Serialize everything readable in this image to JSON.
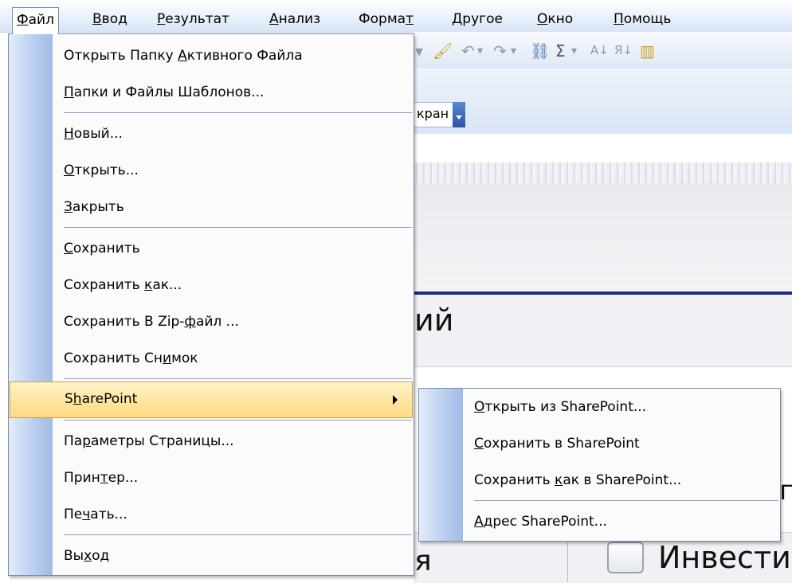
{
  "menubar": [
    {
      "pre": "",
      "u": "Ф",
      "post": "айл",
      "active": true
    },
    {
      "pre": "",
      "u": "В",
      "post": "вод"
    },
    {
      "pre": "",
      "u": "Р",
      "post": "езультат"
    },
    {
      "pre": "",
      "u": "А",
      "post": "нализ"
    },
    {
      "pre": "Форма",
      "u": "т",
      "post": ""
    },
    {
      "pre": "",
      "u": "Д",
      "post": "ругое"
    },
    {
      "pre": "",
      "u": "О",
      "post": "кно"
    },
    {
      "pre": "",
      "u": "П",
      "post": "омощь"
    }
  ],
  "background": {
    "ekran_label": "кран",
    "fragment_ij": "ий",
    "fragment_ya": "я",
    "fragment_invest": "Инвести",
    "fragment_p": "п"
  },
  "file_menu": [
    {
      "pre": "Открыть Папку ",
      "u": "А",
      "post": "ктивного Файла"
    },
    {
      "pre": "",
      "u": "П",
      "post": "апки и Файлы Шаблонов..."
    },
    {
      "sep": true
    },
    {
      "pre": "",
      "u": "Н",
      "post": "овый..."
    },
    {
      "pre": "",
      "u": "О",
      "post": "ткрыть..."
    },
    {
      "pre": "",
      "u": "З",
      "post": "акрыть"
    },
    {
      "sep": true
    },
    {
      "pre": "",
      "u": "С",
      "post": "охранить"
    },
    {
      "pre": "Сохранить ",
      "u": "к",
      "post": "ак..."
    },
    {
      "pre": "Сохранить В Zip-",
      "u": "ф",
      "post": "айл ..."
    },
    {
      "pre": "Сохранить Сн",
      "u": "и",
      "post": "мок"
    },
    {
      "sep": true
    },
    {
      "pre": "S",
      "u": "h",
      "post": "arePoint",
      "submenu": true,
      "highlight": true
    },
    {
      "sep": true
    },
    {
      "pre": "Па",
      "u": "р",
      "post": "аметры Страницы..."
    },
    {
      "pre": "Прин",
      "u": "т",
      "post": "ер..."
    },
    {
      "pre": "Пе",
      "u": "ч",
      "post": "ать..."
    },
    {
      "sep": true
    },
    {
      "pre": "Вы",
      "u": "х",
      "post": "од"
    }
  ],
  "sharepoint_menu": [
    {
      "pre": "",
      "u": "О",
      "post": "ткрыть из SharePoint..."
    },
    {
      "pre": "",
      "u": "С",
      "post": "охранить в SharePoint"
    },
    {
      "pre": "Сохранить ",
      "u": "к",
      "post": "ак в SharePoint..."
    },
    {
      "sep": true
    },
    {
      "pre": "",
      "u": "А",
      "post": "дрес SharePoint..."
    }
  ],
  "icons": [
    "brush-icon",
    "undo-icon",
    "redo-icon",
    "link-icon",
    "sum-icon",
    "sort-asc-icon",
    "sort-desc-icon",
    "chart-icon"
  ]
}
